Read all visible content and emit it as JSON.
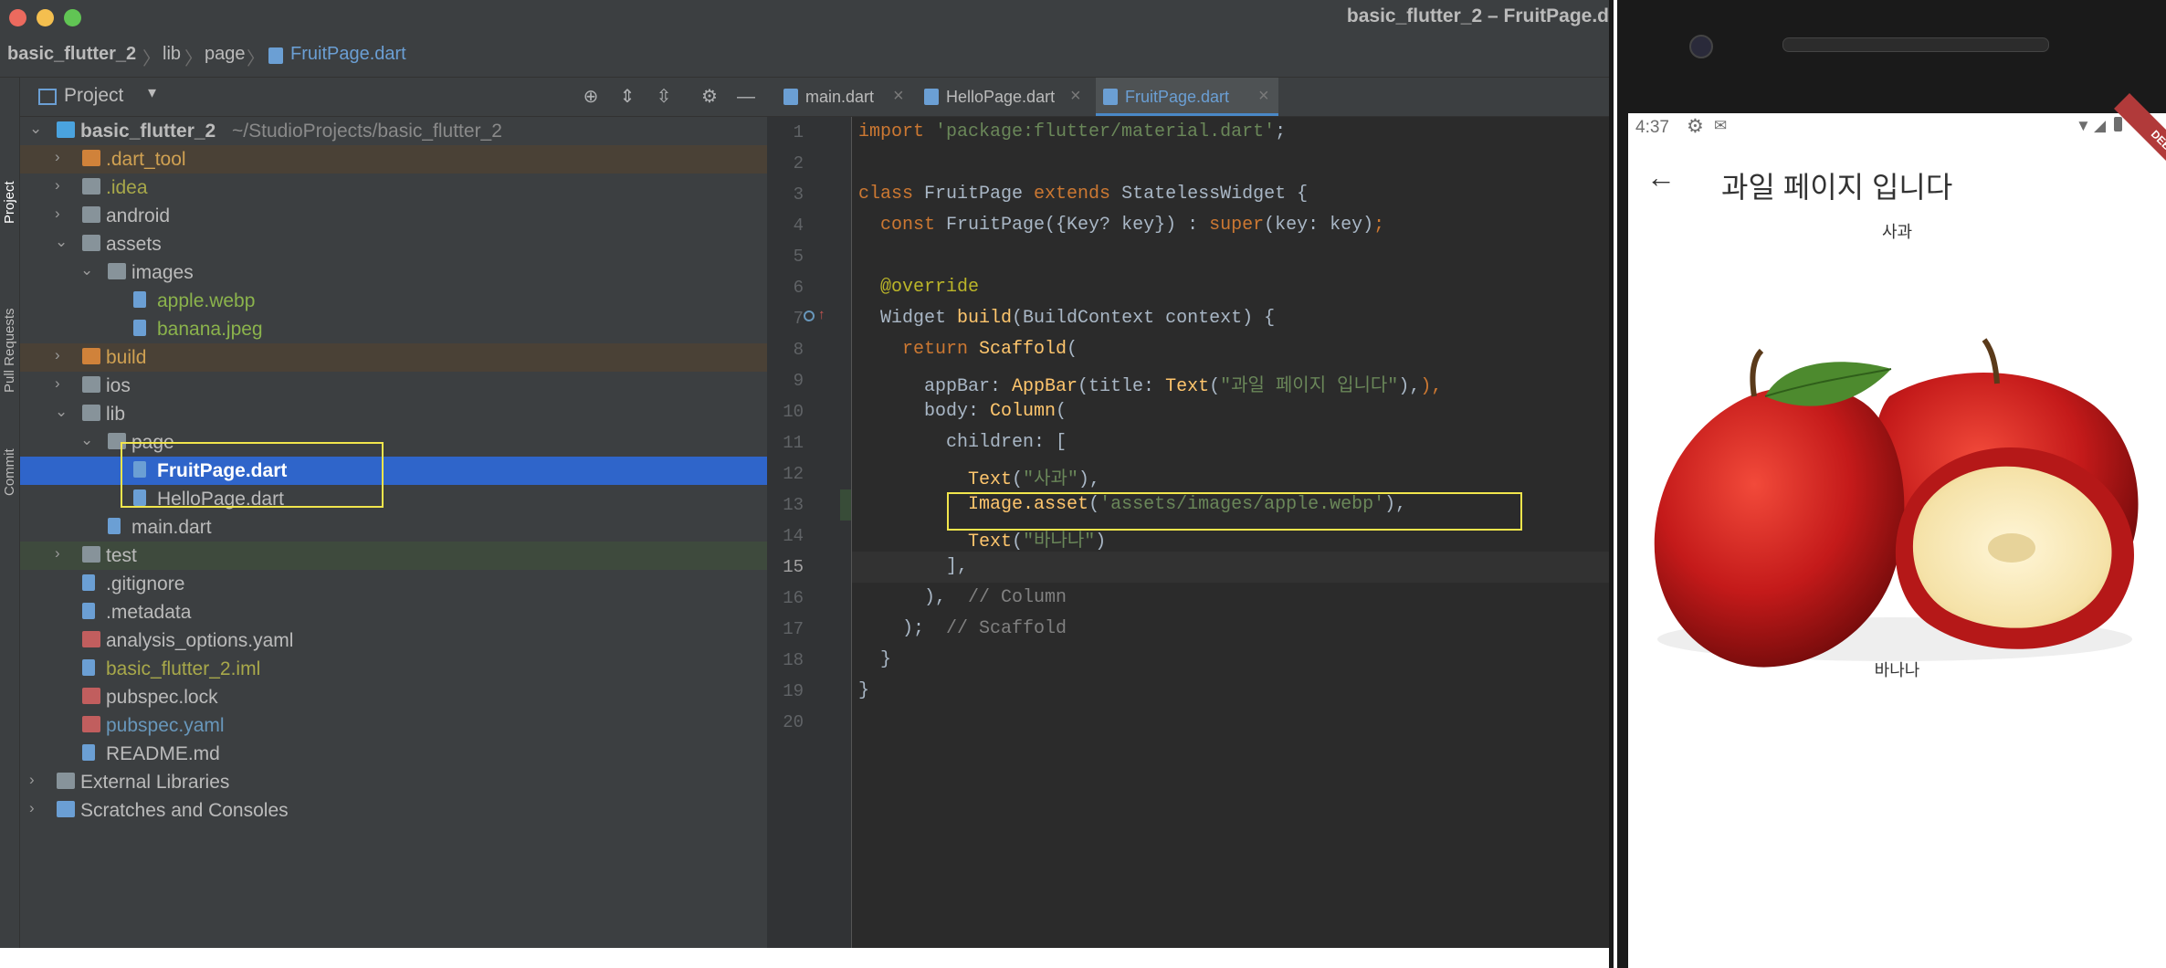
{
  "window": {
    "title": "basic_flutter_2 – FruitPage.d"
  },
  "breadcrumb": [
    "basic_flutter_2",
    "lib",
    "page",
    "FruitPage.dart"
  ],
  "left_strip": [
    "Project",
    "Pull Requests",
    "Commit"
  ],
  "project_panel": {
    "title": "Project",
    "root": {
      "name": "basic_flutter_2",
      "path": "~/StudioProjects/basic_flutter_2"
    },
    "items": [
      {
        "name": ".dart_tool",
        "depth": 1,
        "kind": "folder",
        "arrow": "›",
        "color": "#d0a152",
        "bg": "#4a4136"
      },
      {
        "name": ".idea",
        "depth": 1,
        "kind": "folder",
        "arrow": "›",
        "color": "#a8a84a",
        "bg": ""
      },
      {
        "name": "android",
        "depth": 1,
        "kind": "folder",
        "arrow": "›",
        "color": "#bbbbbb",
        "bg": ""
      },
      {
        "name": "assets",
        "depth": 1,
        "kind": "folder",
        "arrow": "⌄",
        "color": "#bbbbbb",
        "bg": ""
      },
      {
        "name": "images",
        "depth": 2,
        "kind": "folder",
        "arrow": "⌄",
        "color": "#bbbbbb",
        "bg": ""
      },
      {
        "name": "apple.webp",
        "depth": 3,
        "kind": "file",
        "arrow": "",
        "color": "#8bb34c",
        "bg": ""
      },
      {
        "name": "banana.jpeg",
        "depth": 3,
        "kind": "file",
        "arrow": "",
        "color": "#8bb34c",
        "bg": ""
      },
      {
        "name": "build",
        "depth": 1,
        "kind": "folder",
        "arrow": "›",
        "color": "#d0a152",
        "bg": "#4a4136"
      },
      {
        "name": "ios",
        "depth": 1,
        "kind": "folder",
        "arrow": "›",
        "color": "#bbbbbb",
        "bg": ""
      },
      {
        "name": "lib",
        "depth": 1,
        "kind": "folder",
        "arrow": "⌄",
        "color": "#bbbbbb",
        "bg": ""
      },
      {
        "name": "page",
        "depth": 2,
        "kind": "folder",
        "arrow": "⌄",
        "color": "#bbbbbb",
        "bg": ""
      },
      {
        "name": "FruitPage.dart",
        "depth": 3,
        "kind": "file",
        "arrow": "",
        "color": "#ffffff",
        "bg": "#2f65ca"
      },
      {
        "name": "HelloPage.dart",
        "depth": 3,
        "kind": "file",
        "arrow": "",
        "color": "#bbbbbb",
        "bg": ""
      },
      {
        "name": "main.dart",
        "depth": 2,
        "kind": "file",
        "arrow": "",
        "color": "#bbbbbb",
        "bg": ""
      },
      {
        "name": "test",
        "depth": 1,
        "kind": "folder",
        "arrow": "›",
        "color": "#bbbbbb",
        "bg": "#3e4a3d"
      },
      {
        "name": ".gitignore",
        "depth": 1,
        "kind": "file",
        "arrow": "",
        "color": "#bbbbbb",
        "bg": ""
      },
      {
        "name": ".metadata",
        "depth": 1,
        "kind": "file",
        "arrow": "",
        "color": "#bbbbbb",
        "bg": ""
      },
      {
        "name": "analysis_options.yaml",
        "depth": 1,
        "kind": "yaml",
        "arrow": "",
        "color": "#bbbbbb",
        "bg": ""
      },
      {
        "name": "basic_flutter_2.iml",
        "depth": 1,
        "kind": "file",
        "arrow": "",
        "color": "#a8a84a",
        "bg": ""
      },
      {
        "name": "pubspec.lock",
        "depth": 1,
        "kind": "yaml",
        "arrow": "",
        "color": "#bbbbbb",
        "bg": ""
      },
      {
        "name": "pubspec.yaml",
        "depth": 1,
        "kind": "yaml",
        "arrow": "",
        "color": "#6897bb",
        "bg": ""
      },
      {
        "name": "README.md",
        "depth": 1,
        "kind": "file",
        "arrow": "",
        "color": "#bbbbbb",
        "bg": ""
      },
      {
        "name": "External Libraries",
        "depth": 0,
        "kind": "lib",
        "arrow": "›",
        "color": "#bbbbbb",
        "bg": ""
      },
      {
        "name": "Scratches and Consoles",
        "depth": 0,
        "kind": "scratch",
        "arrow": "›",
        "color": "#bbbbbb",
        "bg": ""
      }
    ]
  },
  "tabs": [
    {
      "label": "main.dart",
      "active": false
    },
    {
      "label": "HelloPage.dart",
      "active": false
    },
    {
      "label": "FruitPage.dart",
      "active": true
    }
  ],
  "code_lines": [
    [
      [
        "kw",
        "import "
      ],
      [
        "str",
        "'package:flutter/material.dart'"
      ],
      [
        "",
        "; "
      ]
    ],
    [],
    [
      [
        "kw",
        "class "
      ],
      [
        "",
        "FruitPage "
      ],
      [
        "kw",
        "extends "
      ],
      [
        "",
        "StatelessWidget {"
      ]
    ],
    [
      [
        "",
        "  "
      ],
      [
        "kw",
        "const "
      ],
      [
        "",
        "FruitPage({Key? key}) : "
      ],
      [
        "kw",
        "super"
      ],
      [
        "",
        "(key: key)"
      ],
      [
        "kw",
        ";"
      ]
    ],
    [],
    [
      [
        "",
        "  "
      ],
      [
        "an",
        "@override"
      ]
    ],
    [
      [
        "",
        "  Widget "
      ],
      [
        "fn",
        "build"
      ],
      [
        "",
        "(BuildContext context) {"
      ]
    ],
    [
      [
        "",
        "    "
      ],
      [
        "kw",
        "return "
      ],
      [
        "fn",
        "Scaffold"
      ],
      [
        "",
        "("
      ]
    ],
    [
      [
        "",
        "      appBar: "
      ],
      [
        "fn",
        "AppBar"
      ],
      [
        "",
        "(title: "
      ],
      [
        "fn",
        "Text"
      ],
      [
        "",
        "("
      ],
      [
        "str",
        "\"과일 페이지 입니다\""
      ],
      [
        "",
        "),"
      ],
      [
        "kw",
        "),"
      ]
    ],
    [
      [
        "",
        "      body: "
      ],
      [
        "fn",
        "Column"
      ],
      [
        "",
        "("
      ]
    ],
    [
      [
        "",
        "        children: ["
      ]
    ],
    [
      [
        "",
        "          "
      ],
      [
        "fn",
        "Text"
      ],
      [
        "",
        "("
      ],
      [
        "str",
        "\"사과\""
      ],
      [
        "",
        "),"
      ]
    ],
    [
      [
        "",
        "          "
      ],
      [
        "fn",
        "Image.asset"
      ],
      [
        "",
        "("
      ],
      [
        "str",
        "'assets/images/apple.webp'"
      ],
      [
        "",
        "),"
      ]
    ],
    [
      [
        "",
        "          "
      ],
      [
        "fn",
        "Text"
      ],
      [
        "",
        "("
      ],
      [
        "str",
        "\"바나나\""
      ],
      [
        "",
        ")"
      ]
    ],
    [
      [
        "",
        "        ],"
      ]
    ],
    [
      [
        "",
        "      ),  "
      ],
      [
        "cm",
        "// Column"
      ]
    ],
    [
      [
        "",
        "    );  "
      ],
      [
        "cm",
        "// Scaffold"
      ]
    ],
    [
      [
        "",
        "  }"
      ]
    ],
    [
      [
        "",
        "}"
      ]
    ],
    []
  ],
  "current_line": 15,
  "phone": {
    "status_time": "4:37",
    "debug_banner": "DEBUG",
    "app_title": "과일 페이지 입니다",
    "text1": "사과",
    "text2": "바나나"
  },
  "colors": {
    "selection": "#2f65ca",
    "highlight_box": "#f1e54c"
  }
}
